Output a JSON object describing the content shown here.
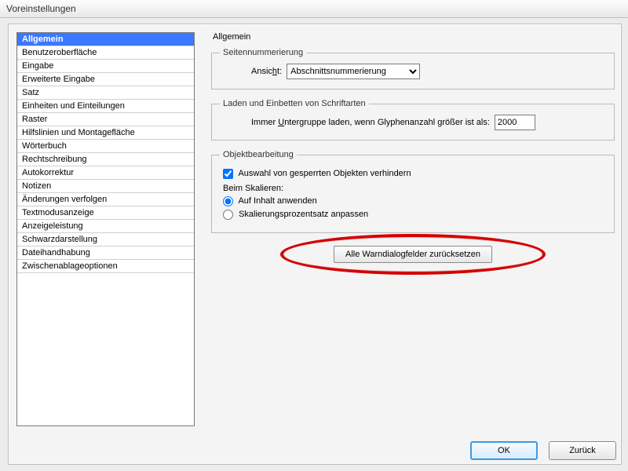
{
  "window": {
    "title": "Voreinstellungen"
  },
  "sidebar": {
    "selected_index": 0,
    "items": [
      "Allgemein",
      "Benutzeroberfläche",
      "Eingabe",
      "Erweiterte Eingabe",
      "Satz",
      "Einheiten und Einteilungen",
      "Raster",
      "Hilfslinien und Montagefläche",
      "Wörterbuch",
      "Rechtschreibung",
      "Autokorrektur",
      "Notizen",
      "Änderungen verfolgen",
      "Textmodusanzeige",
      "Anzeigeleistung",
      "Schwarzdarstellung",
      "Dateihandhabung",
      "Zwischenablageoptionen"
    ]
  },
  "content": {
    "title": "Allgemein",
    "page_numbering": {
      "legend": "Seitennummerierung",
      "view_label_pre": "Ansic",
      "view_label_accel": "h",
      "view_label_post": "t:",
      "view_value": "Abschnittsnummerierung"
    },
    "font_embed": {
      "legend": "Laden und Einbetten von Schriftarten",
      "line_pre": "Immer ",
      "line_accel": "U",
      "line_post": "ntergruppe laden, wenn Glyphenanzahl größer ist als:",
      "threshold": "2000"
    },
    "object_edit": {
      "legend": "Objektbearbeitung",
      "prevent_locked_label": "Auswahl von gesperrten Objekten verhindern",
      "prevent_locked_checked": true,
      "scaling_heading": "Beim Skalieren:",
      "radio_content": "Auf Inhalt anwenden",
      "radio_percent": "Skalierungsprozentsatz anpassen",
      "radio_selected": "content"
    },
    "reset_button": "Alle Warndialogfelder zurücksetzen"
  },
  "footer": {
    "ok": "OK",
    "cancel": "Zurück"
  }
}
